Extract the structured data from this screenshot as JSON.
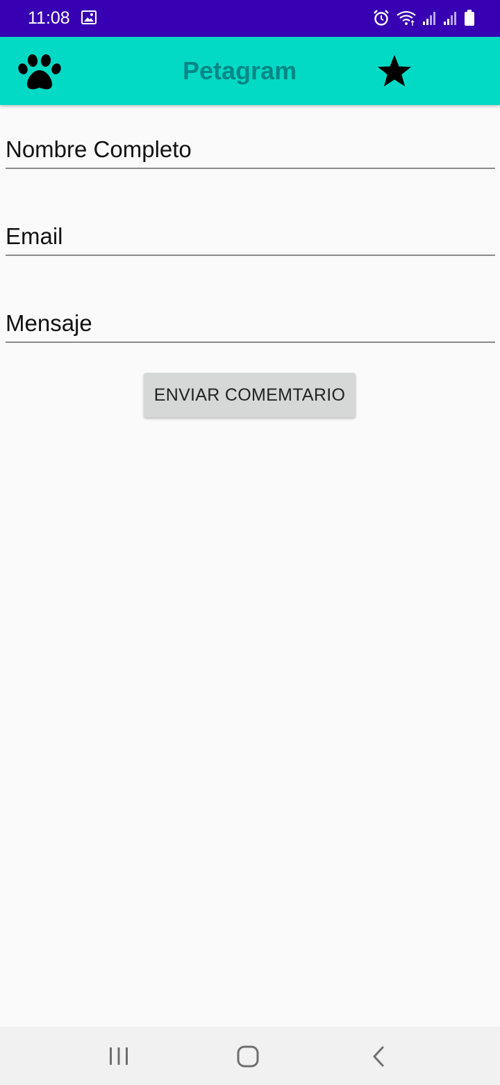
{
  "status_bar": {
    "time": "11:08",
    "icons": [
      "image-icon",
      "alarm-icon",
      "wifi-icon",
      "signal-icon",
      "signal-icon",
      "battery-icon"
    ],
    "background": "#3700b3"
  },
  "app_bar": {
    "title": "Petagram",
    "left_icon": "paw-icon",
    "right_icon": "star-icon",
    "background": "#03dac5",
    "title_color": "#018786"
  },
  "form": {
    "name_placeholder": "Nombre Completo",
    "email_placeholder": "Email",
    "message_placeholder": "Mensaje",
    "submit_label": "ENVIAR COMEMTARIO"
  },
  "nav_bar": {
    "icons": [
      "recent-apps-icon",
      "home-icon",
      "back-icon"
    ]
  }
}
